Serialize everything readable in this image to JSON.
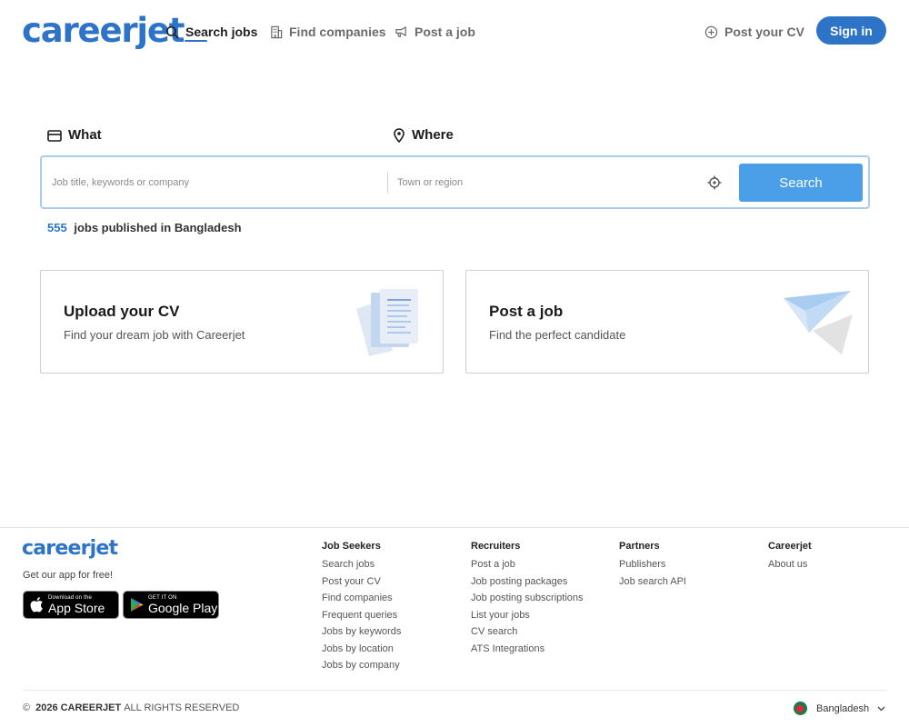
{
  "brand": {
    "logo": "careerjet"
  },
  "nav": {
    "search_jobs": "Search jobs",
    "find_companies": "Find companies",
    "post_job": "Post a job",
    "post_cv": "Post your CV",
    "sign_in": "Sign in"
  },
  "search": {
    "what_label": "What",
    "what_placeholder": "Job title, keywords or company",
    "what_value": "",
    "where_label": "Where",
    "where_placeholder": "Town or region",
    "where_value": "",
    "button": "Search"
  },
  "jobs_count": {
    "number": "555",
    "text": "jobs published in Bangladesh"
  },
  "cards": [
    {
      "title": "Upload your CV",
      "subtitle": "Find your dream job with Careerjet",
      "icon": "document-illustration"
    },
    {
      "title": "Post a job",
      "subtitle": "Find the perfect candidate",
      "icon": "paper-plane-illustration"
    }
  ],
  "footer": {
    "logo": "careerjet",
    "app_text": "Get our app for free!",
    "app_store": {
      "small": "Download on the",
      "big": "App Store"
    },
    "google_play": {
      "small": "GET IT ON",
      "big": "Google Play"
    },
    "columns": [
      {
        "heading": "Job Seekers",
        "links": [
          "Search jobs",
          "Post your CV",
          "Find companies",
          "Frequent queries",
          "Jobs by keywords",
          "Jobs by location",
          "Jobs by company"
        ]
      },
      {
        "heading": "Recruiters",
        "links": [
          "Post a job",
          "Job posting packages",
          "Job posting subscriptions",
          "List your jobs",
          "CV search",
          "ATS Integrations"
        ]
      },
      {
        "heading": "Partners",
        "links": [
          "Publishers",
          "Job search API"
        ]
      },
      {
        "heading": "Careerjet",
        "links": [
          "About us"
        ]
      }
    ],
    "copyright_symbol": "©",
    "copyright_year": "2026",
    "copyright_brand": "CAREERJET",
    "copyright_rest": "ALL RIGHTS RESERVED",
    "country": "Bangladesh"
  },
  "colors": {
    "brand": "#2d74c8",
    "search_button": "#4a9fe8",
    "flag_green": "#1b7a4a",
    "flag_red": "#e0263a"
  }
}
